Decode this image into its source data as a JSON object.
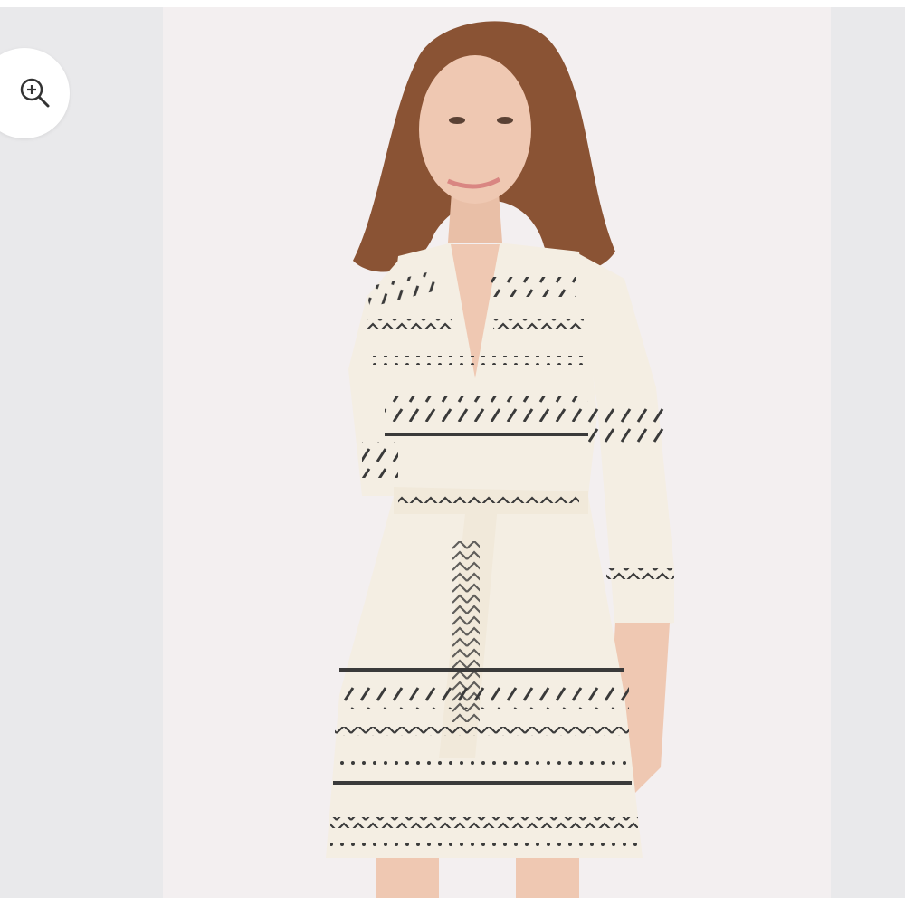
{
  "viewer": {
    "zoom_icon": "zoom-in-icon",
    "product_image": "model-wearing-white-embroidered-dress"
  },
  "colors": {
    "page_bg": "#ffffff",
    "side_panels": "#e9e9eb",
    "photo_bg": "#f3eff0",
    "dress": "#f4eee3",
    "embroidery": "#3a3a3a",
    "hair": "#8a5334"
  }
}
